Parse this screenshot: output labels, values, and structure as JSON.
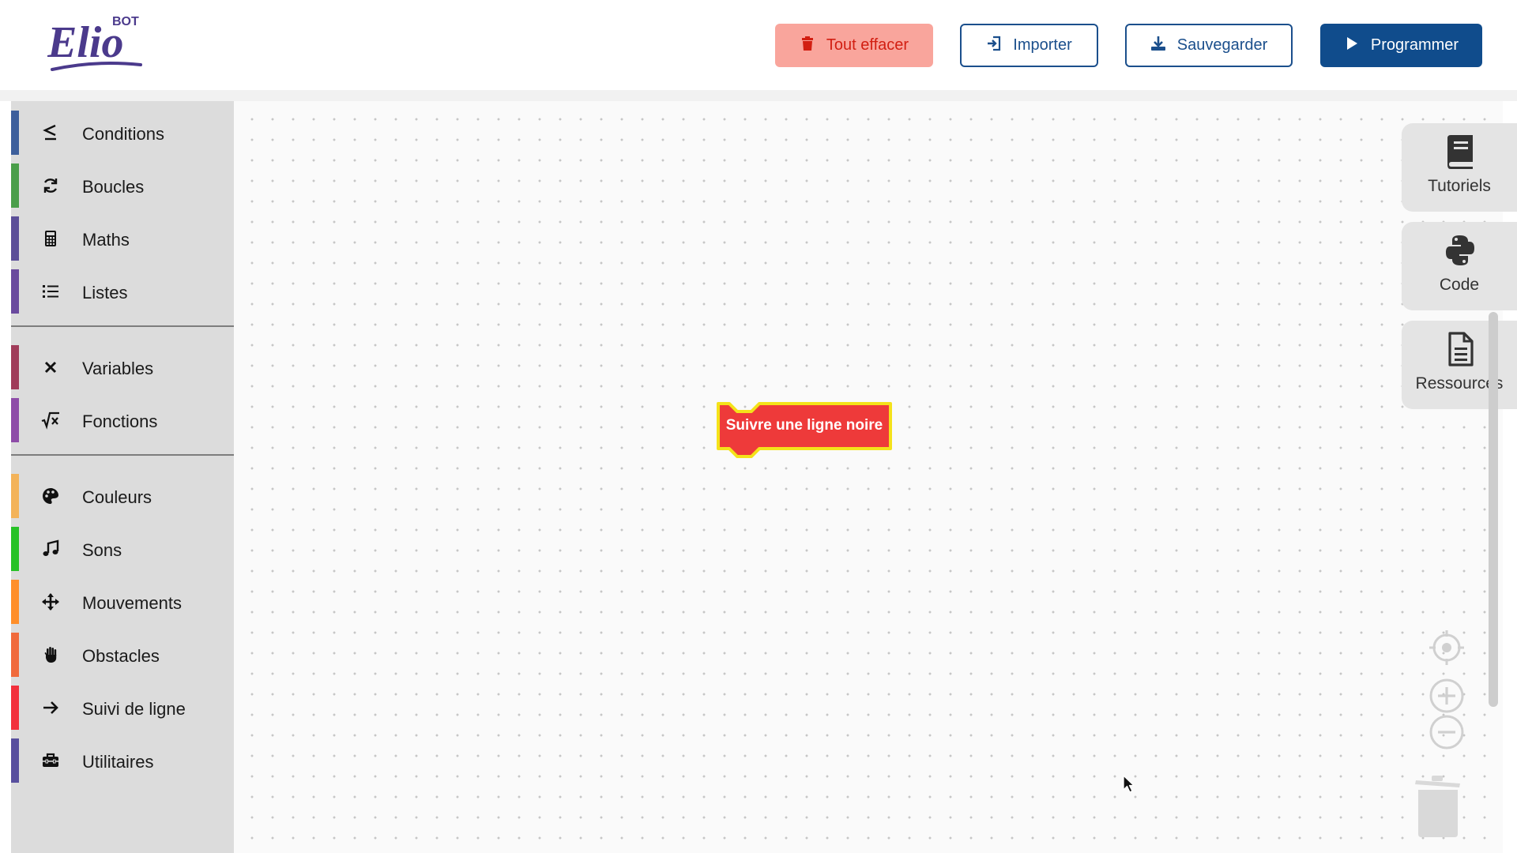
{
  "app": {
    "logo_text": "Elio",
    "logo_badge": "BOT"
  },
  "toolbar": {
    "clear_label": "Tout effacer",
    "import_label": "Importer",
    "save_label": "Sauvegarder",
    "run_label": "Programmer"
  },
  "sidebar": {
    "items": [
      {
        "label": "Conditions",
        "icon": "less-equal-icon",
        "color": "#3d5f9c"
      },
      {
        "label": "Boucles",
        "icon": "refresh-icon",
        "color": "#4a9e4a"
      },
      {
        "label": "Maths",
        "icon": "calculator-icon",
        "color": "#5c4f98"
      },
      {
        "label": "Listes",
        "icon": "list-icon",
        "color": "#6a4a9e"
      },
      {
        "label": "Variables",
        "icon": "times-icon",
        "color": "#a03c5a"
      },
      {
        "label": "Fonctions",
        "icon": "square-root-icon",
        "color": "#8e4ca8"
      },
      {
        "label": "Couleurs",
        "icon": "palette-icon",
        "color": "#f3b35a"
      },
      {
        "label": "Sons",
        "icon": "music-icon",
        "color": "#27c227"
      },
      {
        "label": "Mouvements",
        "icon": "arrows-move-icon",
        "color": "#ff8f2a"
      },
      {
        "label": "Obstacles",
        "icon": "hand-icon",
        "color": "#f06a3c"
      },
      {
        "label": "Suivi de ligne",
        "icon": "arrow-right-icon",
        "color": "#f2303c"
      },
      {
        "label": "Utilitaires",
        "icon": "toolbox-icon",
        "color": "#584f9e"
      }
    ]
  },
  "workspace": {
    "block_label": "Suivre une ligne noire",
    "block_color": "#ee3a3a",
    "block_outline": "#f4e21a"
  },
  "right_tabs": [
    {
      "label": "Tutoriels",
      "icon": "book-icon"
    },
    {
      "label": "Code",
      "icon": "python-icon"
    },
    {
      "label": "Ressources",
      "icon": "file-icon"
    }
  ],
  "colors": {
    "primary": "#104c8c",
    "danger_bg": "#f9a59c",
    "danger_text": "#d21f12"
  }
}
